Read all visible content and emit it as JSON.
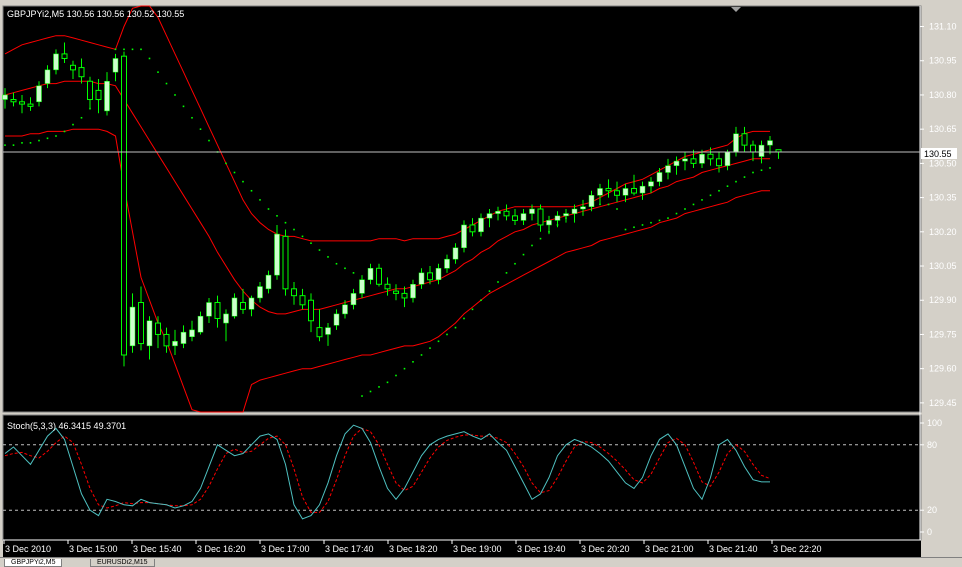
{
  "main_chart": {
    "title": "GBPJPYi2,M5  130.56 130.56 130.52 130.55",
    "current_price": "130.55",
    "price_labels": [
      "131.10",
      "130.95",
      "130.80",
      "130.65",
      "130.50",
      "130.35",
      "130.20",
      "130.05",
      "129.90",
      "129.75",
      "129.60",
      "129.45"
    ]
  },
  "stoch": {
    "title": "Stoch(5,3,3) 46.3415 49.3701",
    "levels": [
      "100",
      "80",
      "20",
      "0"
    ]
  },
  "time_labels": [
    "3 Dec 2010",
    "3 Dec 15:00",
    "3 Dec 15:40",
    "3 Dec 16:20",
    "3 Dec 17:00",
    "3 Dec 17:40",
    "3 Dec 18:20",
    "3 Dec 19:00",
    "3 Dec 19:40",
    "3 Dec 20:20",
    "3 Dec 21:00",
    "3 Dec 21:40",
    "3 Dec 22:20"
  ],
  "tabs": [
    "GBPJPYi2,M5",
    "EURUSDi2,M15"
  ],
  "colors": {
    "background": "#000000",
    "up_candle": "#ccffcc",
    "candle_wick": "#00ff00",
    "bands": "#ff0000",
    "sar": "#00ff00",
    "stoch_main": "#4ec0c0",
    "stoch_signal": "#ff0000"
  },
  "chart_data": {
    "type": "candlestick",
    "ylim": [
      129.41,
      131.19
    ],
    "candles": [
      {
        "o": 130.78,
        "h": 130.83,
        "l": 130.74,
        "c": 130.8
      },
      {
        "o": 130.78,
        "h": 130.81,
        "l": 130.75,
        "c": 130.77
      },
      {
        "o": 130.77,
        "h": 130.8,
        "l": 130.72,
        "c": 130.76
      },
      {
        "o": 130.76,
        "h": 130.79,
        "l": 130.73,
        "c": 130.75
      },
      {
        "o": 130.77,
        "h": 130.86,
        "l": 130.75,
        "c": 130.84
      },
      {
        "o": 130.85,
        "h": 130.93,
        "l": 130.83,
        "c": 130.91
      },
      {
        "o": 130.91,
        "h": 131.0,
        "l": 130.89,
        "c": 130.98
      },
      {
        "o": 130.98,
        "h": 131.03,
        "l": 130.94,
        "c": 130.96
      },
      {
        "o": 130.93,
        "h": 130.95,
        "l": 130.87,
        "c": 130.91
      },
      {
        "o": 130.92,
        "h": 130.96,
        "l": 130.85,
        "c": 130.88
      },
      {
        "o": 130.86,
        "h": 130.88,
        "l": 130.74,
        "c": 130.78
      },
      {
        "o": 130.82,
        "h": 130.87,
        "l": 130.72,
        "c": 130.78
      },
      {
        "o": 130.73,
        "h": 130.9,
        "l": 130.71,
        "c": 130.86
      },
      {
        "o": 130.9,
        "h": 130.98,
        "l": 130.86,
        "c": 130.96
      },
      {
        "o": 130.97,
        "h": 130.99,
        "l": 129.61,
        "c": 129.66
      },
      {
        "o": 129.7,
        "h": 129.93,
        "l": 129.67,
        "c": 129.87
      },
      {
        "o": 129.89,
        "h": 129.96,
        "l": 129.68,
        "c": 129.71
      },
      {
        "o": 129.7,
        "h": 129.83,
        "l": 129.64,
        "c": 129.81
      },
      {
        "o": 129.8,
        "h": 129.83,
        "l": 129.69,
        "c": 129.75
      },
      {
        "o": 129.75,
        "h": 129.78,
        "l": 129.67,
        "c": 129.7
      },
      {
        "o": 129.7,
        "h": 129.77,
        "l": 129.66,
        "c": 129.72
      },
      {
        "o": 129.71,
        "h": 129.79,
        "l": 129.69,
        "c": 129.76
      },
      {
        "o": 129.74,
        "h": 129.81,
        "l": 129.72,
        "c": 129.77
      },
      {
        "o": 129.76,
        "h": 129.85,
        "l": 129.75,
        "c": 129.83
      },
      {
        "o": 129.83,
        "h": 129.91,
        "l": 129.8,
        "c": 129.89
      },
      {
        "o": 129.89,
        "h": 129.92,
        "l": 129.78,
        "c": 129.82
      },
      {
        "o": 129.8,
        "h": 129.86,
        "l": 129.72,
        "c": 129.84
      },
      {
        "o": 129.83,
        "h": 129.93,
        "l": 129.82,
        "c": 129.91
      },
      {
        "o": 129.89,
        "h": 129.95,
        "l": 129.84,
        "c": 129.86
      },
      {
        "o": 129.86,
        "h": 129.92,
        "l": 129.83,
        "c": 129.91
      },
      {
        "o": 129.91,
        "h": 129.98,
        "l": 129.89,
        "c": 129.96
      },
      {
        "o": 129.95,
        "h": 130.03,
        "l": 129.93,
        "c": 130.01
      },
      {
        "o": 130.01,
        "h": 130.23,
        "l": 129.99,
        "c": 130.19
      },
      {
        "o": 130.18,
        "h": 130.21,
        "l": 129.92,
        "c": 129.95
      },
      {
        "o": 129.95,
        "h": 129.98,
        "l": 129.88,
        "c": 129.92
      },
      {
        "o": 129.92,
        "h": 129.95,
        "l": 129.86,
        "c": 129.88
      },
      {
        "o": 129.9,
        "h": 129.93,
        "l": 129.76,
        "c": 129.81
      },
      {
        "o": 129.78,
        "h": 129.86,
        "l": 129.72,
        "c": 129.74
      },
      {
        "o": 129.75,
        "h": 129.8,
        "l": 129.7,
        "c": 129.78
      },
      {
        "o": 129.79,
        "h": 129.86,
        "l": 129.77,
        "c": 129.84
      },
      {
        "o": 129.84,
        "h": 129.9,
        "l": 129.82,
        "c": 129.88
      },
      {
        "o": 129.88,
        "h": 129.95,
        "l": 129.86,
        "c": 129.93
      },
      {
        "o": 129.93,
        "h": 130.01,
        "l": 129.91,
        "c": 129.99
      },
      {
        "o": 129.99,
        "h": 130.06,
        "l": 129.97,
        "c": 130.04
      },
      {
        "o": 130.04,
        "h": 130.06,
        "l": 129.96,
        "c": 129.97
      },
      {
        "o": 129.97,
        "h": 130.0,
        "l": 129.92,
        "c": 129.95
      },
      {
        "o": 129.94,
        "h": 129.97,
        "l": 129.9,
        "c": 129.93
      },
      {
        "o": 129.93,
        "h": 129.96,
        "l": 129.87,
        "c": 129.91
      },
      {
        "o": 129.91,
        "h": 129.99,
        "l": 129.89,
        "c": 129.97
      },
      {
        "o": 129.97,
        "h": 130.04,
        "l": 129.95,
        "c": 130.02
      },
      {
        "o": 130.02,
        "h": 130.05,
        "l": 129.97,
        "c": 129.99
      },
      {
        "o": 129.99,
        "h": 130.06,
        "l": 129.97,
        "c": 130.04
      },
      {
        "o": 130.04,
        "h": 130.1,
        "l": 130.02,
        "c": 130.08
      },
      {
        "o": 130.08,
        "h": 130.15,
        "l": 130.06,
        "c": 130.13
      },
      {
        "o": 130.13,
        "h": 130.25,
        "l": 130.11,
        "c": 130.23
      },
      {
        "o": 130.23,
        "h": 130.26,
        "l": 130.18,
        "c": 130.2
      },
      {
        "o": 130.2,
        "h": 130.28,
        "l": 130.18,
        "c": 130.26
      },
      {
        "o": 130.26,
        "h": 130.3,
        "l": 130.22,
        "c": 130.28
      },
      {
        "o": 130.28,
        "h": 130.31,
        "l": 130.25,
        "c": 130.29
      },
      {
        "o": 130.29,
        "h": 130.32,
        "l": 130.25,
        "c": 130.27
      },
      {
        "o": 130.27,
        "h": 130.3,
        "l": 130.23,
        "c": 130.25
      },
      {
        "o": 130.25,
        "h": 130.3,
        "l": 130.23,
        "c": 130.28
      },
      {
        "o": 130.28,
        "h": 130.32,
        "l": 130.25,
        "c": 130.3
      },
      {
        "o": 130.3,
        "h": 130.32,
        "l": 130.2,
        "c": 130.23
      },
      {
        "o": 130.23,
        "h": 130.27,
        "l": 130.19,
        "c": 130.25
      },
      {
        "o": 130.25,
        "h": 130.29,
        "l": 130.22,
        "c": 130.27
      },
      {
        "o": 130.27,
        "h": 130.3,
        "l": 130.24,
        "c": 130.28
      },
      {
        "o": 130.28,
        "h": 130.32,
        "l": 130.24,
        "c": 130.3
      },
      {
        "o": 130.3,
        "h": 130.34,
        "l": 130.27,
        "c": 130.31
      },
      {
        "o": 130.31,
        "h": 130.38,
        "l": 130.29,
        "c": 130.36
      },
      {
        "o": 130.36,
        "h": 130.41,
        "l": 130.32,
        "c": 130.39
      },
      {
        "o": 130.39,
        "h": 130.43,
        "l": 130.35,
        "c": 130.38
      },
      {
        "o": 130.38,
        "h": 130.42,
        "l": 130.33,
        "c": 130.36
      },
      {
        "o": 130.36,
        "h": 130.41,
        "l": 130.33,
        "c": 130.39
      },
      {
        "o": 130.39,
        "h": 130.45,
        "l": 130.36,
        "c": 130.37
      },
      {
        "o": 130.37,
        "h": 130.42,
        "l": 130.34,
        "c": 130.4
      },
      {
        "o": 130.4,
        "h": 130.44,
        "l": 130.37,
        "c": 130.42
      },
      {
        "o": 130.42,
        "h": 130.48,
        "l": 130.4,
        "c": 130.46
      },
      {
        "o": 130.46,
        "h": 130.52,
        "l": 130.43,
        "c": 130.49
      },
      {
        "o": 130.49,
        "h": 130.53,
        "l": 130.45,
        "c": 130.51
      },
      {
        "o": 130.51,
        "h": 130.55,
        "l": 130.47,
        "c": 130.52
      },
      {
        "o": 130.52,
        "h": 130.56,
        "l": 130.48,
        "c": 130.5
      },
      {
        "o": 130.5,
        "h": 130.56,
        "l": 130.48,
        "c": 130.54
      },
      {
        "o": 130.54,
        "h": 130.57,
        "l": 130.49,
        "c": 130.52
      },
      {
        "o": 130.52,
        "h": 130.55,
        "l": 130.46,
        "c": 130.49
      },
      {
        "o": 130.49,
        "h": 130.56,
        "l": 130.47,
        "c": 130.55
      },
      {
        "o": 130.55,
        "h": 130.66,
        "l": 130.53,
        "c": 130.63
      },
      {
        "o": 130.63,
        "h": 130.66,
        "l": 130.55,
        "c": 130.58
      },
      {
        "o": 130.58,
        "h": 130.6,
        "l": 130.51,
        "c": 130.55
      },
      {
        "o": 130.53,
        "h": 130.6,
        "l": 130.5,
        "c": 130.58
      },
      {
        "o": 130.58,
        "h": 130.62,
        "l": 130.54,
        "c": 130.6
      },
      {
        "o": 130.56,
        "h": 130.56,
        "l": 130.52,
        "c": 130.55
      }
    ],
    "bands": {
      "upper": [
        130.98,
        131.0,
        131.02,
        131.03,
        131.04,
        131.05,
        131.06,
        131.06,
        131.05,
        131.04,
        131.03,
        131.02,
        131.01,
        131.0,
        131.1,
        131.18,
        131.22,
        131.2,
        131.14,
        131.06,
        130.98,
        130.9,
        130.82,
        130.74,
        130.66,
        130.58,
        130.5,
        130.42,
        130.34,
        130.28,
        130.24,
        130.21,
        130.19,
        130.18,
        130.18,
        130.17,
        130.16,
        130.16,
        130.16,
        130.16,
        130.16,
        130.16,
        130.16,
        130.16,
        130.17,
        130.17,
        130.17,
        130.16,
        130.17,
        130.17,
        130.17,
        130.17,
        130.18,
        130.19,
        130.21,
        130.23,
        130.25,
        130.27,
        130.29,
        130.3,
        130.31,
        130.31,
        130.31,
        130.31,
        130.31,
        130.31,
        130.31,
        130.31,
        130.32,
        130.33,
        130.35,
        130.37,
        130.39,
        130.41,
        130.42,
        130.43,
        130.45,
        130.47,
        130.49,
        130.51,
        130.53,
        130.54,
        130.55,
        130.56,
        130.57,
        130.58,
        130.61,
        130.63,
        130.64,
        130.64,
        130.64
      ],
      "middle": [
        130.8,
        130.81,
        130.82,
        130.83,
        130.84,
        130.85,
        130.85,
        130.86,
        130.86,
        130.86,
        130.86,
        130.85,
        130.85,
        130.84,
        130.78,
        130.72,
        130.66,
        130.6,
        130.54,
        130.48,
        130.42,
        130.36,
        130.3,
        130.24,
        130.18,
        130.11,
        130.05,
        129.99,
        129.94,
        129.9,
        129.87,
        129.85,
        129.84,
        129.84,
        129.85,
        129.86,
        129.86,
        129.86,
        129.87,
        129.88,
        129.89,
        129.9,
        129.91,
        129.92,
        129.93,
        129.94,
        129.95,
        129.95,
        129.96,
        129.97,
        129.98,
        129.99,
        130.01,
        130.03,
        130.06,
        130.08,
        130.11,
        130.13,
        130.16,
        130.18,
        130.2,
        130.21,
        130.23,
        130.24,
        130.25,
        130.26,
        130.27,
        130.28,
        130.29,
        130.3,
        130.31,
        130.32,
        130.33,
        130.34,
        130.35,
        130.36,
        130.37,
        130.39,
        130.4,
        130.42,
        130.43,
        130.44,
        130.46,
        130.47,
        130.48,
        130.49,
        130.5,
        130.51,
        130.52,
        130.52,
        130.52
      ],
      "lower": [
        130.62,
        130.62,
        130.62,
        130.63,
        130.63,
        130.64,
        130.64,
        130.64,
        130.65,
        130.65,
        130.65,
        130.65,
        130.64,
        130.62,
        130.4,
        130.2,
        130.0,
        129.9,
        129.8,
        129.72,
        129.62,
        129.52,
        129.42,
        129.3,
        129.2,
        129.1,
        129.0,
        128.95,
        129.4,
        129.53,
        129.55,
        129.56,
        129.57,
        129.58,
        129.59,
        129.6,
        129.6,
        129.61,
        129.62,
        129.63,
        129.64,
        129.65,
        129.66,
        129.66,
        129.67,
        129.68,
        129.69,
        129.7,
        129.7,
        129.71,
        129.72,
        129.74,
        129.77,
        129.8,
        129.84,
        129.87,
        129.9,
        129.93,
        129.95,
        129.97,
        129.99,
        130.01,
        130.03,
        130.05,
        130.07,
        130.09,
        130.11,
        130.12,
        130.13,
        130.14,
        130.16,
        130.17,
        130.18,
        130.19,
        130.2,
        130.21,
        130.22,
        130.24,
        130.25,
        130.26,
        130.28,
        130.29,
        130.3,
        130.31,
        130.32,
        130.33,
        130.35,
        130.36,
        130.37,
        130.38,
        130.38
      ]
    },
    "sar": [
      130.58,
      130.58,
      130.59,
      130.59,
      130.6,
      130.61,
      130.62,
      130.64,
      130.67,
      130.7,
      130.74,
      130.78,
      130.83,
      131.0,
      131.0,
      131.0,
      131.0,
      130.96,
      130.9,
      130.85,
      130.8,
      130.75,
      130.7,
      130.65,
      130.6,
      130.55,
      130.5,
      130.46,
      130.42,
      130.38,
      130.34,
      130.3,
      130.27,
      130.24,
      130.21,
      130.18,
      130.15,
      130.12,
      130.09,
      130.06,
      130.04,
      130.02,
      129.48,
      129.5,
      129.52,
      129.54,
      129.57,
      129.6,
      129.63,
      129.66,
      129.69,
      129.72,
      129.75,
      129.78,
      129.82,
      129.86,
      129.9,
      129.94,
      129.98,
      130.02,
      130.06,
      130.1,
      130.14,
      130.17,
      130.2,
      130.23,
      130.26,
      130.29,
      130.31,
      130.32,
      130.32,
      130.32,
      130.3,
      130.21,
      130.22,
      130.23,
      130.24,
      130.25,
      130.26,
      130.28,
      130.3,
      130.32,
      130.34,
      130.36,
      130.38,
      130.4,
      130.42,
      130.44,
      130.46,
      130.47,
      130.48
    ],
    "stoch_main": [
      72,
      78,
      70,
      62,
      75,
      88,
      95,
      85,
      60,
      35,
      20,
      15,
      30,
      28,
      25,
      24,
      30,
      27,
      26,
      25,
      22,
      24,
      28,
      40,
      60,
      80,
      75,
      70,
      72,
      80,
      88,
      90,
      85,
      62,
      25,
      12,
      15,
      25,
      45,
      70,
      90,
      98,
      95,
      82,
      60,
      40,
      30,
      40,
      55,
      70,
      80,
      85,
      88,
      90,
      92,
      88,
      85,
      90,
      82,
      75,
      60,
      45,
      30,
      35,
      50,
      70,
      80,
      85,
      82,
      78,
      72,
      65,
      55,
      45,
      40,
      50,
      70,
      85,
      90,
      80,
      60,
      40,
      30,
      50,
      80,
      85,
      75,
      60,
      48,
      46,
      46
    ],
    "stoch_signal": [
      70,
      72,
      73,
      70,
      68,
      74,
      82,
      88,
      82,
      62,
      40,
      25,
      22,
      24,
      27,
      26,
      27,
      27,
      26,
      25,
      24,
      24,
      25,
      30,
      42,
      58,
      72,
      76,
      73,
      74,
      80,
      86,
      88,
      80,
      58,
      32,
      18,
      18,
      28,
      48,
      70,
      88,
      95,
      92,
      80,
      62,
      45,
      38,
      42,
      55,
      68,
      78,
      84,
      87,
      89,
      89,
      88,
      88,
      86,
      82,
      72,
      60,
      45,
      36,
      38,
      50,
      65,
      78,
      83,
      82,
      78,
      72,
      65,
      57,
      48,
      45,
      53,
      68,
      82,
      86,
      80,
      64,
      46,
      42,
      55,
      72,
      80,
      74,
      62,
      52,
      49
    ]
  }
}
